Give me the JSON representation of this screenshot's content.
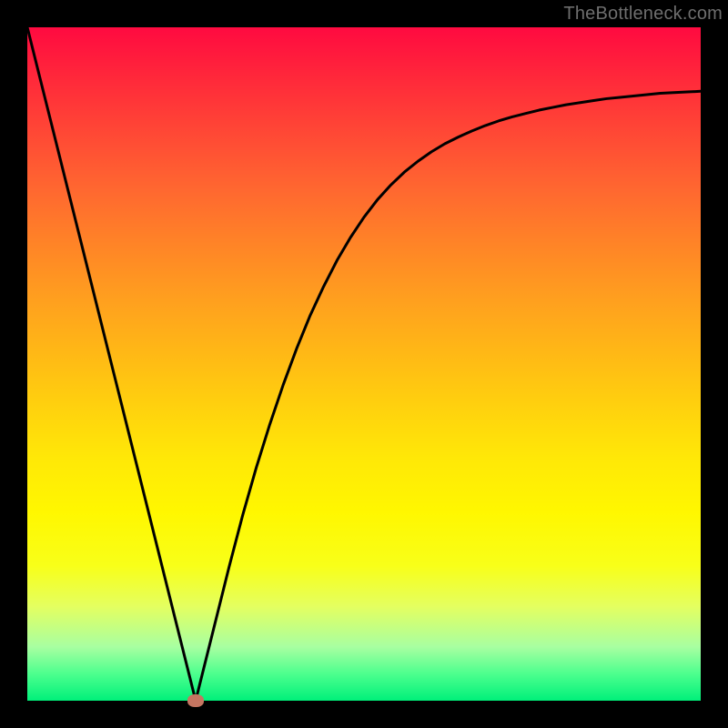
{
  "watermark": "TheBottleneck.com",
  "chart_data": {
    "type": "line",
    "title": "",
    "xlabel": "",
    "ylabel": "",
    "xlim": [
      0,
      100
    ],
    "ylim": [
      0,
      100
    ],
    "marker": {
      "x": 25,
      "y": 0
    },
    "x": [
      0,
      2,
      4,
      6,
      8,
      10,
      12,
      14,
      16,
      18,
      20,
      22,
      24,
      25,
      26,
      28,
      30,
      32,
      34,
      36,
      38,
      40,
      42,
      44,
      46,
      48,
      50,
      52,
      54,
      56,
      58,
      60,
      62,
      64,
      66,
      68,
      70,
      72,
      74,
      76,
      78,
      80,
      82,
      84,
      86,
      88,
      90,
      92,
      94,
      96,
      98,
      100
    ],
    "values": [
      100,
      92,
      84,
      76,
      68,
      60,
      52,
      44,
      36,
      28,
      20,
      12,
      4,
      0,
      4,
      12,
      20,
      27.6,
      34.6,
      41,
      46.9,
      52.3,
      57.2,
      61.5,
      65.4,
      68.8,
      71.8,
      74.4,
      76.6,
      78.5,
      80.1,
      81.5,
      82.7,
      83.7,
      84.6,
      85.4,
      86.1,
      86.7,
      87.2,
      87.7,
      88.1,
      88.5,
      88.8,
      89.1,
      89.4,
      89.6,
      89.8,
      90.0,
      90.2,
      90.3,
      90.4,
      90.5
    ]
  }
}
